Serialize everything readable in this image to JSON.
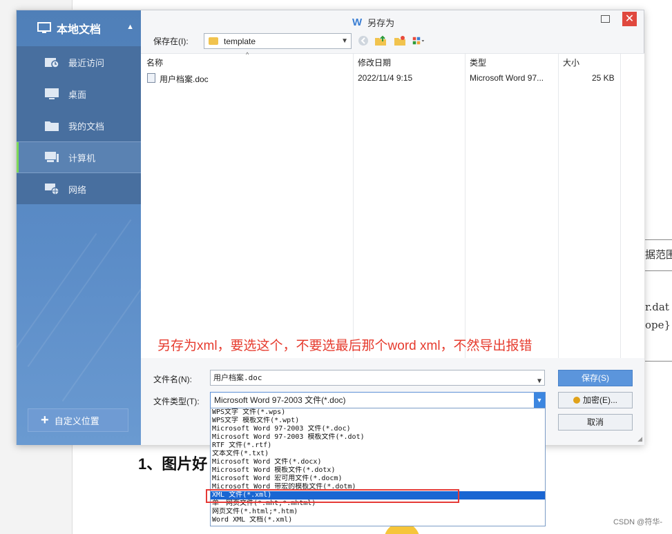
{
  "background": {
    "snippets": [
      "据范围",
      "r.dat",
      "ope}"
    ],
    "heading": "1、图片好",
    "credit": "CSDN @符华-"
  },
  "dialog": {
    "title": "另存为",
    "title_icon": "W",
    "sidebar": {
      "header": "本地文档",
      "items": [
        {
          "label": "最近访问",
          "icon": "recent-icon"
        },
        {
          "label": "桌面",
          "icon": "desktop-icon"
        },
        {
          "label": "我的文档",
          "icon": "folder-icon"
        },
        {
          "label": "计算机",
          "icon": "computer-icon",
          "active": true
        },
        {
          "label": "网络",
          "icon": "network-icon"
        }
      ],
      "custom_location": "自定义位置"
    },
    "save_in": {
      "label": "保存在(I):",
      "value": "template"
    },
    "columns": {
      "name": "名称",
      "modified": "修改日期",
      "type": "类型",
      "size": "大小"
    },
    "files": [
      {
        "name": "用户档案.doc",
        "modified": "2022/11/4 9:15",
        "type": "Microsoft Word 97...",
        "size": "25 KB"
      }
    ],
    "annotation": "另存为xml，要选这个，不要选最后那个word xml，不然导出报错",
    "filename": {
      "label": "文件名(N):",
      "value": "用户档案.doc"
    },
    "filetype": {
      "label": "文件类型(T):",
      "value": "Microsoft Word 97-2003 文件(*.doc)",
      "options": [
        "WPS文字 文件(*.wps)",
        "WPS文字 模板文件(*.wpt)",
        "Microsoft Word 97-2003 文件(*.doc)",
        "Microsoft Word 97-2003 模板文件(*.dot)",
        "RTF 文件(*.rtf)",
        "文本文件(*.txt)",
        "Microsoft Word 文件(*.docx)",
        "Microsoft Word 模板文件(*.dotx)",
        "Microsoft Word 宏可用文件(*.docm)",
        "Microsoft Word 带宏的模板文件(*.dotm)",
        "XML 文件(*.xml)",
        "单一网页文件(*.mht;*.mhtml)",
        "网页文件(*.html;*.htm)",
        "Word XML 文档(*.xml)"
      ],
      "selected_index": 10
    },
    "buttons": {
      "save": "保存(S)",
      "encrypt": "加密(E)...",
      "cancel": "取消"
    }
  },
  "colors": {
    "accent": "#5b95dc",
    "annotation": "#e63b2e",
    "highlight": "#e53935",
    "selection": "#1a66d2"
  }
}
